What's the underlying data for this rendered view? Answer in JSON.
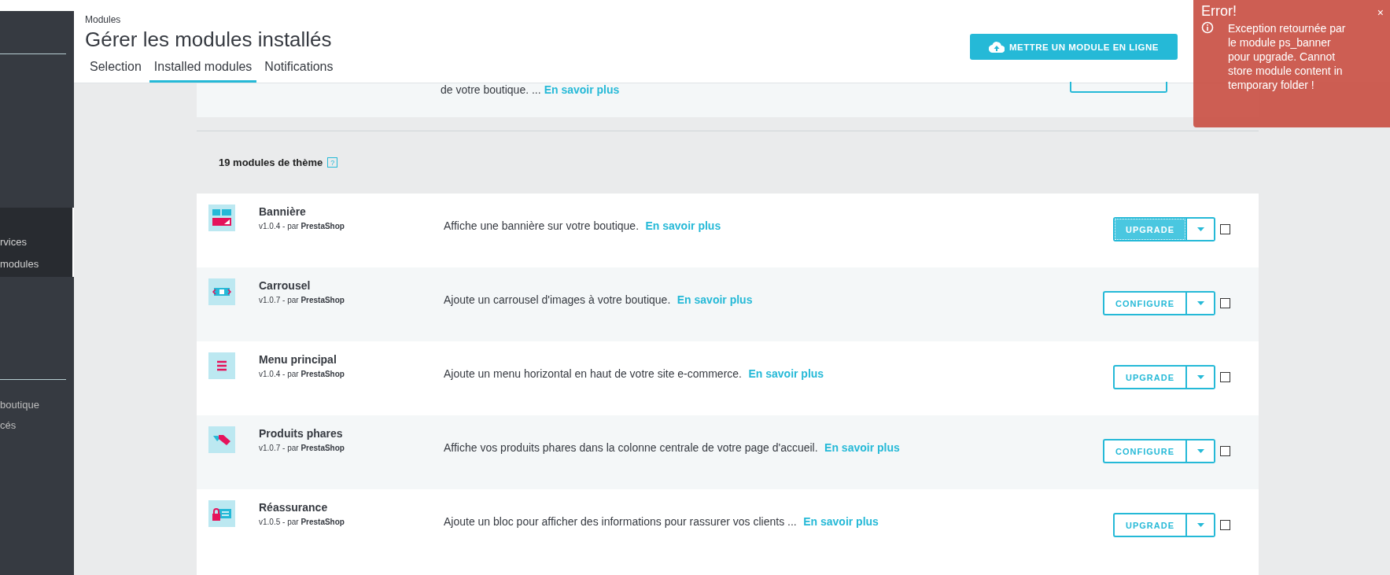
{
  "sidebar": {
    "items": [
      {
        "label": "rvices",
        "selected": true
      },
      {
        "label": "modules",
        "selected": true
      },
      {
        "label": "boutique",
        "selected": false
      },
      {
        "label": "cés",
        "selected": false
      }
    ]
  },
  "header": {
    "breadcrumb": "Modules",
    "title": "Gérer les modules installés",
    "upload_button": "METTRE UN MODULE EN LIGNE"
  },
  "tabs": [
    {
      "label": "Selection",
      "selected": false
    },
    {
      "label": "Installed modules",
      "selected": true
    },
    {
      "label": "Notifications",
      "selected": false
    }
  ],
  "partial_row": {
    "description": "de votre boutique. ...",
    "link": "En savoir plus"
  },
  "section": {
    "title": "19 modules de thème",
    "help": "?"
  },
  "modules": [
    {
      "kind": "banner",
      "name": "Bannière",
      "version": "v1.0.4 - par",
      "author": "PrestaShop",
      "description": "Affiche une bannière sur votre boutique.",
      "link": "En savoir plus",
      "action": "UPGRADE",
      "focused": true,
      "checked": false
    },
    {
      "kind": "carousel",
      "name": "Carrousel",
      "version": "v1.0.7 - par",
      "author": "PrestaShop",
      "description": "Ajoute un carrousel d'images à votre boutique.",
      "link": "En savoir plus",
      "action": "CONFIGURE",
      "focused": false,
      "checked": false
    },
    {
      "kind": "menu",
      "name": "Menu principal",
      "version": "v1.0.4 - par",
      "author": "PrestaShop",
      "description": "Ajoute un menu horizontal en haut de votre site e-commerce.",
      "link": "En savoir plus",
      "action": "UPGRADE",
      "focused": false,
      "checked": false
    },
    {
      "kind": "tags",
      "name": "Produits phares",
      "version": "v1.0.7 - par",
      "author": "PrestaShop",
      "description": "Affiche vos produits phares dans la colonne centrale de votre page d'accueil.",
      "link": "En savoir plus",
      "action": "CONFIGURE",
      "focused": false,
      "checked": false
    },
    {
      "kind": "lock",
      "name": "Réassurance",
      "version": "v1.0.5 - par",
      "author": "PrestaShop",
      "description": "Ajoute un bloc pour afficher des informations pour rassurer vos clients ...",
      "link": "En savoir plus",
      "action": "UPGRADE",
      "focused": false,
      "checked": false
    }
  ],
  "error_toast": {
    "title": "Error!",
    "message": "Exception retournée par le module ps_banner pour upgrade. Cannot store module content in temporary folder !",
    "close": "×"
  }
}
